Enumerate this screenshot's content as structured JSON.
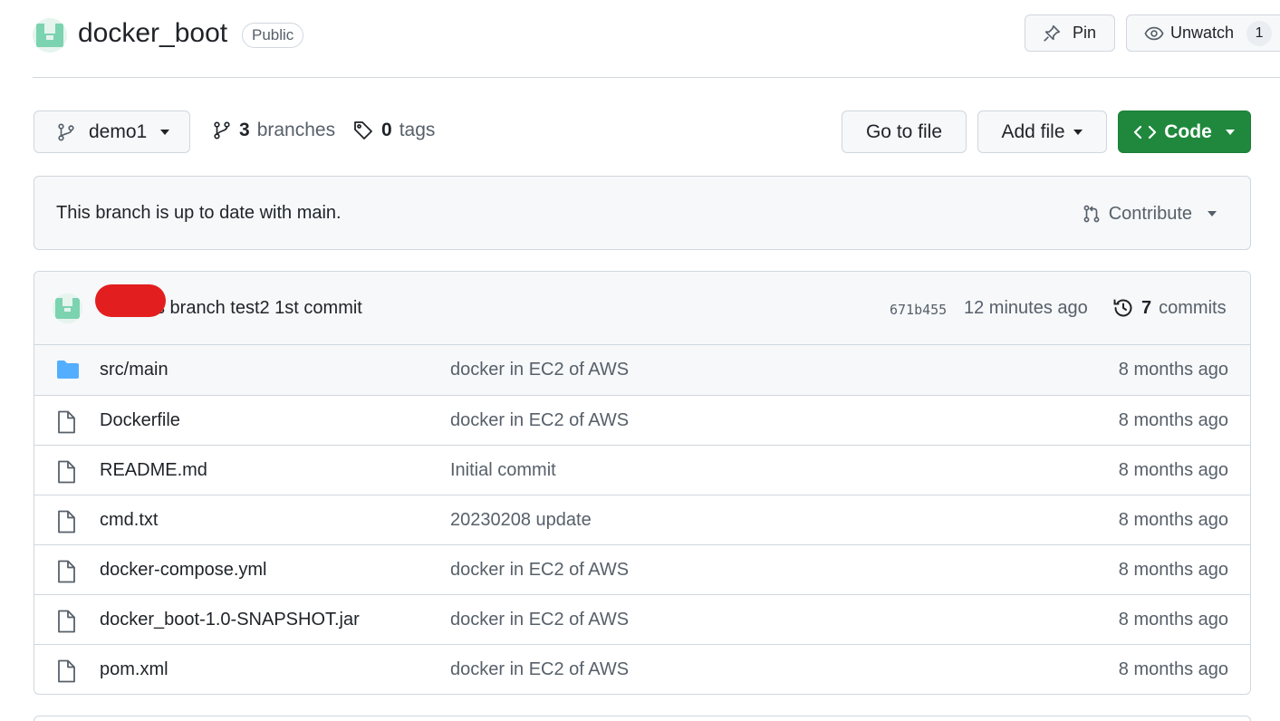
{
  "repo": {
    "name": "docker_boot",
    "visibility": "Public",
    "pin_label": "Pin",
    "unwatch_label": "Unwatch",
    "watch_count": "1"
  },
  "toolbar": {
    "branch": "demo1",
    "branches_count": "3",
    "branches_label": "branches",
    "tags_count": "0",
    "tags_label": "tags",
    "go_to_file": "Go to file",
    "add_file": "Add file",
    "code": "Code"
  },
  "banner": {
    "text": "This branch is up to date with main.",
    "contribute": "Contribute"
  },
  "commit": {
    "message": "s branch test2 1st commit",
    "sha": "671b455",
    "time": "12 minutes ago",
    "commits_count": "7",
    "commits_label": "commits"
  },
  "files": [
    {
      "name": "src/main",
      "type": "folder",
      "message": "docker in EC2 of AWS",
      "age": "8 months ago"
    },
    {
      "name": "Dockerfile",
      "type": "file",
      "message": "docker in EC2 of AWS",
      "age": "8 months ago"
    },
    {
      "name": "README.md",
      "type": "file",
      "message": "Initial commit",
      "age": "8 months ago"
    },
    {
      "name": "cmd.txt",
      "type": "file",
      "message": "20230208 update",
      "age": "8 months ago"
    },
    {
      "name": "docker-compose.yml",
      "type": "file",
      "message": "docker in EC2 of AWS",
      "age": "8 months ago"
    },
    {
      "name": "docker_boot-1.0-SNAPSHOT.jar",
      "type": "file",
      "message": "docker in EC2 of AWS",
      "age": "8 months ago"
    },
    {
      "name": "pom.xml",
      "type": "file",
      "message": "docker in EC2 of AWS",
      "age": "8 months ago"
    }
  ],
  "icons": {
    "folder": "folder-icon",
    "file": "file-icon",
    "branch": "git-branch-icon",
    "tag": "tag-icon",
    "history": "history-icon",
    "pin": "pin-icon",
    "eye": "eye-icon",
    "code": "code-icon",
    "pull-request": "pull-request-icon"
  },
  "colors": {
    "code_button": "#1f883d",
    "folder": "#54aeff",
    "redaction": "#e31e1e",
    "avatar": "#7cd3b0"
  }
}
